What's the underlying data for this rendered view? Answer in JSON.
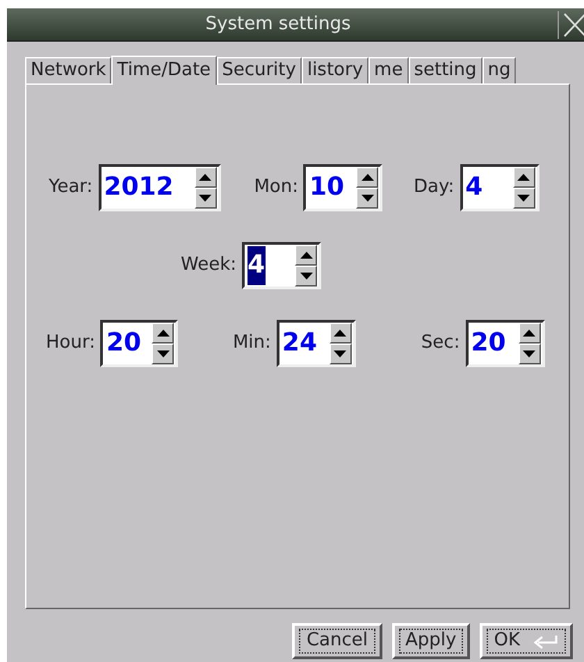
{
  "window": {
    "title": "System settings"
  },
  "tabs": [
    {
      "label": "Network",
      "selected": false
    },
    {
      "label": "Time/Date",
      "selected": true
    },
    {
      "label": "Security",
      "selected": false
    },
    {
      "label": "listory",
      "selected": false
    },
    {
      "label": "me",
      "selected": false
    },
    {
      "label": "setting",
      "selected": false
    },
    {
      "label": "ng",
      "selected": false
    }
  ],
  "spin_rows": [
    [
      {
        "label": "Year:",
        "value": "2012",
        "focused": false
      },
      {
        "label": "Mon:",
        "value": "10",
        "focused": false
      },
      {
        "label": "Day:",
        "value": "4",
        "focused": false
      }
    ],
    [
      {
        "label": "Week:",
        "value": "4",
        "focused": true
      }
    ],
    [
      {
        "label": "Hour:",
        "value": "20",
        "focused": false
      },
      {
        "label": "Min:",
        "value": "24",
        "focused": false
      },
      {
        "label": "Sec:",
        "value": "20",
        "focused": false
      }
    ]
  ],
  "buttons": [
    {
      "label": "Cancel",
      "kind": "plain"
    },
    {
      "label": "Apply",
      "kind": "plain"
    },
    {
      "label": "OK",
      "kind": "enter"
    }
  ]
}
